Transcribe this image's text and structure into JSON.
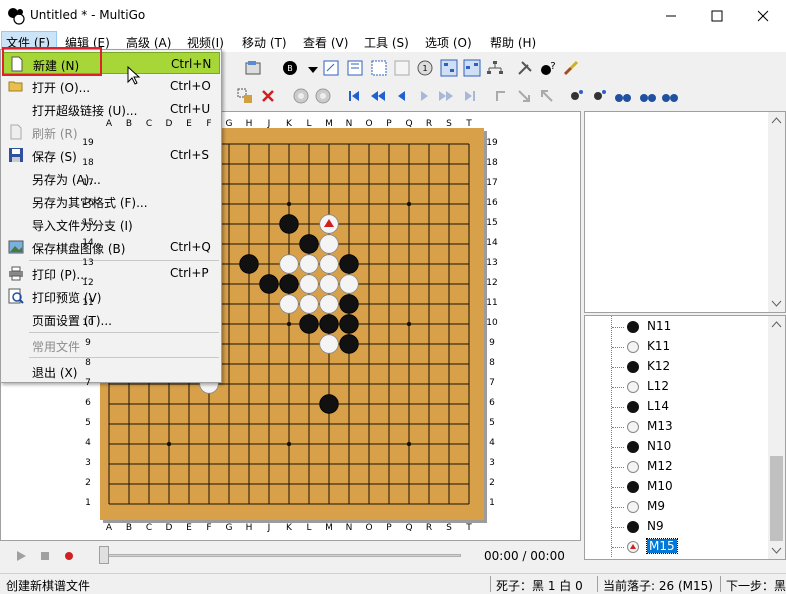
{
  "window": {
    "title": "Untitled  * - MultiGo",
    "minimize_icon": "minimize-icon",
    "maximize_icon": "maximize-icon",
    "close_icon": "close-icon"
  },
  "menubar": {
    "items": [
      "文件 (F)",
      "编辑 (E)",
      "高级 (A)",
      "视频(I)",
      "移动 (T)",
      "查看 (V)",
      "工具 (S)",
      "选项 (O)",
      "帮助 (H)"
    ]
  },
  "file_menu": {
    "items": [
      {
        "label": "新建 (N)",
        "shortcut": "Ctrl+N",
        "icon": "new-file-icon"
      },
      {
        "label": "打开 (O)...",
        "shortcut": "Ctrl+O",
        "icon": "open-folder-icon"
      },
      {
        "label": "打开超级链接 (U)...",
        "shortcut": "Ctrl+U",
        "icon": ""
      },
      {
        "label": "刷新 (R)",
        "shortcut": "",
        "icon": "refresh-icon"
      },
      {
        "label": "保存 (S)",
        "shortcut": "Ctrl+S",
        "icon": "save-icon"
      },
      {
        "label": "另存为 (A)...",
        "shortcut": "",
        "icon": ""
      },
      {
        "label": "另存为其它格式 (F)...",
        "shortcut": "",
        "icon": ""
      },
      {
        "label": "导入文件为分支 (I)",
        "shortcut": "",
        "icon": ""
      },
      {
        "label": "保存棋盘图像 (B)",
        "shortcut": "Ctrl+Q",
        "icon": "image-icon"
      },
      {
        "label": "打印 (P)...",
        "shortcut": "Ctrl+P",
        "icon": "print-icon"
      },
      {
        "label": "打印预览 (V)",
        "shortcut": "",
        "icon": "print-preview-icon"
      },
      {
        "label": "页面设置 (T)...",
        "shortcut": "",
        "icon": ""
      },
      {
        "label": "常用文件",
        "shortcut": "",
        "icon": ""
      },
      {
        "label": "退出 (X)",
        "shortcut": "",
        "icon": ""
      }
    ]
  },
  "board": {
    "col_labels": [
      "A",
      "B",
      "C",
      "D",
      "E",
      "F",
      "G",
      "H",
      "J",
      "K",
      "L",
      "M",
      "N",
      "O",
      "P",
      "Q",
      "R",
      "S",
      "T"
    ],
    "row_labels": [
      "19",
      "18",
      "17",
      "16",
      "15",
      "14",
      "13",
      "12",
      "11",
      "10",
      "9",
      "8",
      "7",
      "6",
      "5",
      "4",
      "3",
      "2",
      "1"
    ],
    "stones": [
      {
        "c": "black",
        "col": 9,
        "row": 15
      },
      {
        "c": "white",
        "col": 11,
        "row": 15
      },
      {
        "c": "black",
        "col": 10,
        "row": 14
      },
      {
        "c": "white",
        "col": 11,
        "row": 14
      },
      {
        "c": "black",
        "col": 7,
        "row": 13
      },
      {
        "c": "white",
        "col": 9,
        "row": 13
      },
      {
        "c": "white",
        "col": 10,
        "row": 13
      },
      {
        "c": "white",
        "col": 11,
        "row": 13
      },
      {
        "c": "black",
        "col": 12,
        "row": 13
      },
      {
        "c": "black",
        "col": 8,
        "row": 12
      },
      {
        "c": "black",
        "col": 9,
        "row": 12
      },
      {
        "c": "white",
        "col": 10,
        "row": 12
      },
      {
        "c": "white",
        "col": 11,
        "row": 12
      },
      {
        "c": "white",
        "col": 12,
        "row": 12
      },
      {
        "c": "white",
        "col": 9,
        "row": 11
      },
      {
        "c": "white",
        "col": 10,
        "row": 11
      },
      {
        "c": "white",
        "col": 11,
        "row": 11
      },
      {
        "c": "black",
        "col": 12,
        "row": 11
      },
      {
        "c": "black",
        "col": 10,
        "row": 10
      },
      {
        "c": "black",
        "col": 11,
        "row": 10
      },
      {
        "c": "black",
        "col": 12,
        "row": 10
      },
      {
        "c": "white",
        "col": 11,
        "row": 9
      },
      {
        "c": "black",
        "col": 12,
        "row": 9
      },
      {
        "c": "white",
        "col": 5,
        "row": 7
      },
      {
        "c": "black",
        "col": 11,
        "row": 6
      }
    ],
    "last_move": {
      "col": 11,
      "row": 15
    }
  },
  "move_tree": {
    "items": [
      {
        "label": "N11",
        "color": "black"
      },
      {
        "label": "K11",
        "color": "white"
      },
      {
        "label": "K12",
        "color": "black"
      },
      {
        "label": "L12",
        "color": "white"
      },
      {
        "label": "L14",
        "color": "black"
      },
      {
        "label": "M13",
        "color": "white"
      },
      {
        "label": "N10",
        "color": "black"
      },
      {
        "label": "M12",
        "color": "white"
      },
      {
        "label": "M10",
        "color": "black"
      },
      {
        "label": "M9",
        "color": "white"
      },
      {
        "label": "N9",
        "color": "black"
      },
      {
        "label": "M15",
        "color": "current"
      }
    ]
  },
  "playback": {
    "time": "00:00 / 00:00"
  },
  "status": {
    "hint": "创建新棋谱文件",
    "captures": "死子：黑 1 白 0",
    "current_move": "当前落子: 26 (M15)",
    "next_move": "下一步：黑"
  },
  "colors": {
    "menu_highlight": "#a6d638",
    "annotation_box": "#e0202a",
    "board_wood": "#d9a04a"
  }
}
